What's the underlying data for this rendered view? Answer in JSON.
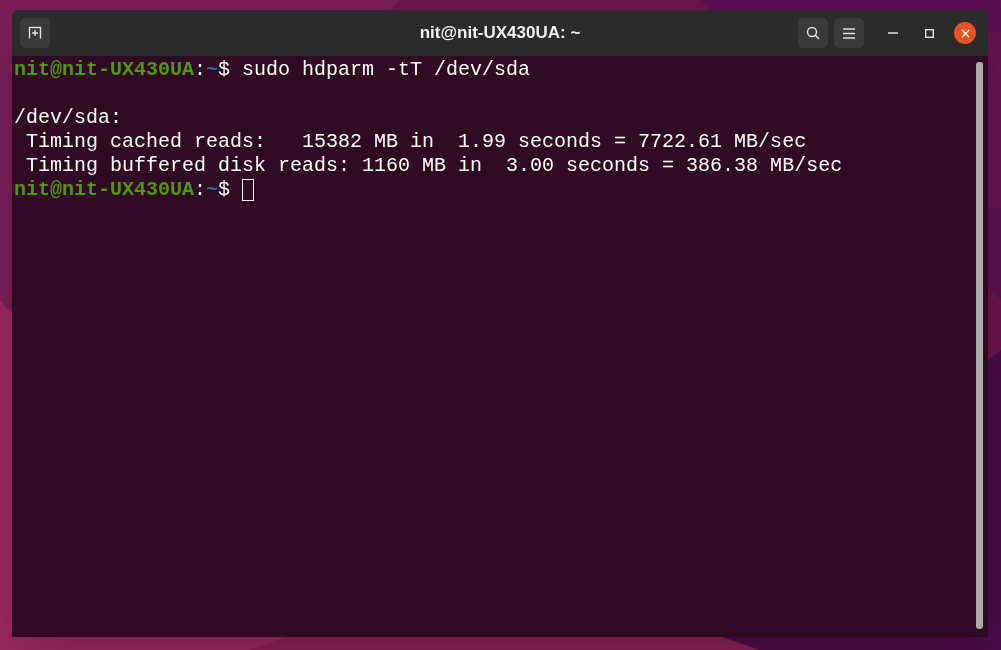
{
  "window": {
    "title": "nit@nit-UX430UA: ~"
  },
  "terminal": {
    "lines": [
      {
        "kind": "prompt",
        "user_host": "nit@nit-UX430UA",
        "separator": ":",
        "path": "~",
        "symbol": "$",
        "command": "sudo hdparm -tT /dev/sda",
        "cursor": false
      },
      {
        "kind": "blank"
      },
      {
        "kind": "output",
        "text": "/dev/sda:"
      },
      {
        "kind": "output",
        "text": " Timing cached reads:   15382 MB in  1.99 seconds = 7722.61 MB/sec"
      },
      {
        "kind": "output",
        "text": " Timing buffered disk reads: 1160 MB in  3.00 seconds = 386.38 MB/sec"
      },
      {
        "kind": "prompt",
        "user_host": "nit@nit-UX430UA",
        "separator": ":",
        "path": "~",
        "symbol": "$",
        "cursor": true
      }
    ]
  }
}
